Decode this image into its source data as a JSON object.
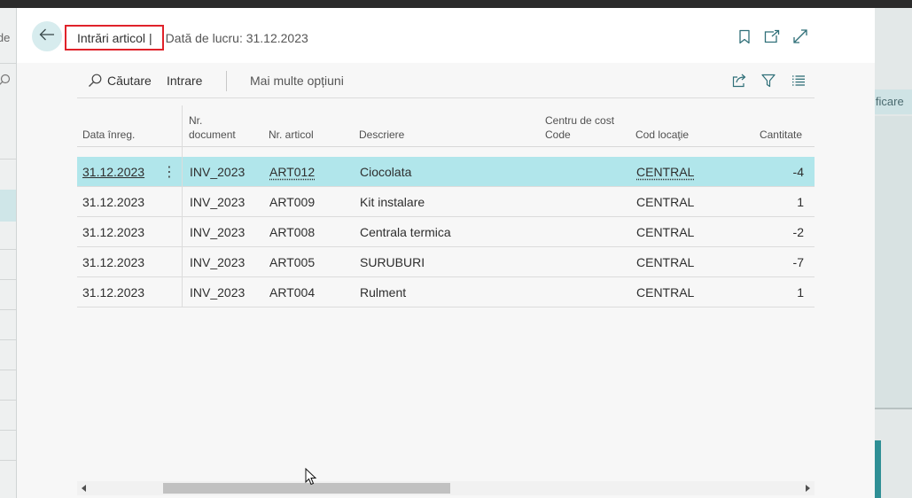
{
  "background": {
    "left_fragment": "ide",
    "right_fragment": "ificare"
  },
  "dialog": {
    "title": "Intrări articol",
    "separator": "|",
    "work_date": "Dată de lucru: 31.12.2023",
    "header_icons": [
      "bookmark-icon",
      "open-new-window-icon",
      "expand-icon"
    ]
  },
  "actions": {
    "search": "Căutare",
    "entry": "Intrare",
    "more_options": "Mai multe opțiuni",
    "right_icons": [
      "share-icon",
      "filter-icon",
      "list-view-icon"
    ]
  },
  "table": {
    "columns": {
      "posting_date": "Data înreg.",
      "doc_no_line1": "Nr.",
      "doc_no_line2": "document",
      "item_no": "Nr. articol",
      "description": "Descriere",
      "cost_center_line1": "Centru de cost",
      "cost_center_line2": "Code",
      "location_code": "Cod locaţie",
      "quantity": "Cantitate"
    },
    "rows": [
      {
        "date": "31.12.2023",
        "doc": "INV_2023",
        "item": "ART012",
        "desc": "Ciocolata",
        "cost_center": "",
        "location": "CENTRAL",
        "qty": "-4",
        "selected": true
      },
      {
        "date": "31.12.2023",
        "doc": "INV_2023",
        "item": "ART009",
        "desc": "Kit instalare",
        "cost_center": "",
        "location": "CENTRAL",
        "qty": "1",
        "selected": false
      },
      {
        "date": "31.12.2023",
        "doc": "INV_2023",
        "item": "ART008",
        "desc": "Centrala termica",
        "cost_center": "",
        "location": "CENTRAL",
        "qty": "-2",
        "selected": false
      },
      {
        "date": "31.12.2023",
        "doc": "INV_2023",
        "item": "ART005",
        "desc": "SURUBURI",
        "cost_center": "",
        "location": "CENTRAL",
        "qty": "-7",
        "selected": false
      },
      {
        "date": "31.12.2023",
        "doc": "INV_2023",
        "item": "ART004",
        "desc": "Rulment",
        "cost_center": "",
        "location": "CENTRAL",
        "qty": "1",
        "selected": false
      }
    ]
  },
  "colors": {
    "accent_teal": "#b1e6eb",
    "highlight_box": "#e0222a",
    "back_button_bg": "#d7ecee"
  }
}
